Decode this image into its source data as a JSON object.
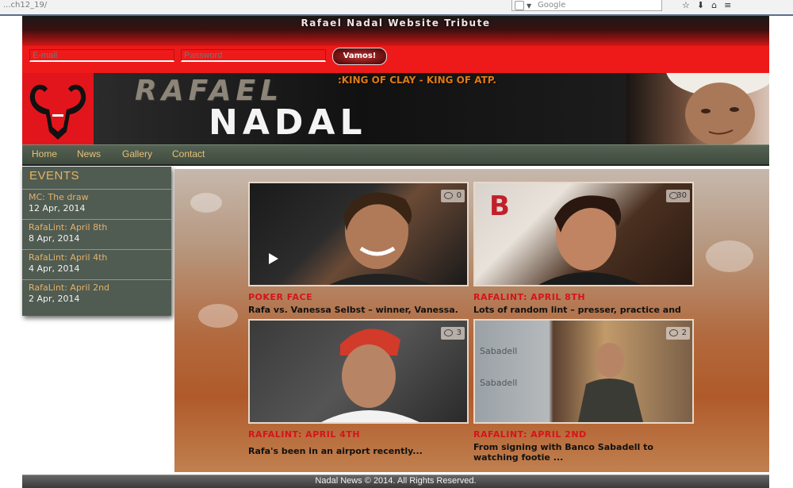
{
  "browser": {
    "url_fragment": "...ch12_19/",
    "search_placeholder": "Google"
  },
  "site": {
    "title": "Rafael Nadal Website Tribute"
  },
  "login": {
    "email_placeholder": "E-mail",
    "password_placeholder": "Password",
    "submit_label": "Vamos!"
  },
  "banner": {
    "name_first": "RAFAEL",
    "name_last": "NADAL",
    "tagline": ":KING OF CLAY - KING OF ATP."
  },
  "nav": {
    "items": [
      {
        "label": "Home"
      },
      {
        "label": "News"
      },
      {
        "label": "Gallery"
      },
      {
        "label": "Contact"
      }
    ]
  },
  "sidebar": {
    "title": "EVENTS",
    "events": [
      {
        "title": "MC: The draw",
        "date": "12 Apr, 2014"
      },
      {
        "title": "RafaLint: April 8th",
        "date": "8 Apr, 2014"
      },
      {
        "title": "RafaLint: April 4th",
        "date": "4 Apr, 2014"
      },
      {
        "title": "RafaLint: April 2nd",
        "date": "2 Apr, 2014"
      }
    ]
  },
  "news": [
    {
      "label": "POKER FACE",
      "desc": "Rafa vs. Vanessa Selbst – winner, Vanessa.",
      "comments": "0",
      "has_video": true
    },
    {
      "label": "RAFALINT: APRIL 8TH",
      "desc": "Lots of random lint – presser, practice and ...",
      "comments": "30",
      "has_video": false
    },
    {
      "label": "RAFALINT: APRIL 4TH",
      "desc": "Rafa's been in an airport recently...",
      "comments": "3",
      "has_video": false
    },
    {
      "label": "RAFALINT: APRIL 2ND",
      "desc": "From signing with Banco Sabadell to watching footie ...",
      "comments": "2",
      "has_video": false
    }
  ],
  "footer": {
    "text": "Nadal News © 2014. All Rights Reserved."
  },
  "colors": {
    "header_red": "#ee1a1a",
    "nav_green": "#505c52",
    "accent_gold": "#e3b06a",
    "label_red": "#d7131a"
  }
}
